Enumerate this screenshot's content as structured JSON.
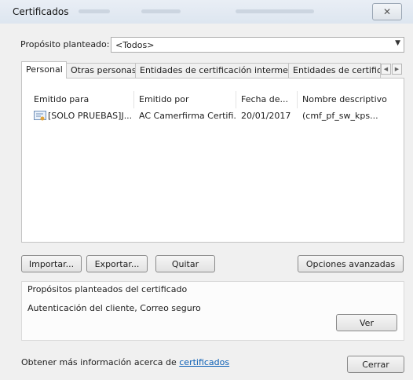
{
  "window": {
    "title": "Certificados",
    "close_symbol": "✕"
  },
  "purpose": {
    "label": "Propósito planteado:",
    "value": "<Todos>"
  },
  "tabs": [
    {
      "label": "Personal",
      "active": true
    },
    {
      "label": "Otras personas",
      "active": false
    },
    {
      "label": "Entidades de certificación intermedias",
      "active": false
    },
    {
      "label": "Entidades de certificaci",
      "active": false
    }
  ],
  "tab_scroll": {
    "left": "◀",
    "right": "▶"
  },
  "table": {
    "columns": [
      "Emitido para",
      "Emitido por",
      "Fecha de...",
      "Nombre descriptivo"
    ],
    "rows": [
      {
        "icon": "certificate-icon",
        "issued_to": "[SOLO PRUEBAS]J...",
        "issued_by": "AC Camerfirma Certifi...",
        "date": "20/01/2017",
        "friendly_name": "(cmf_pf_sw_kps..."
      }
    ]
  },
  "buttons": {
    "import": "Importar...",
    "export": "Exportar...",
    "remove": "Quitar",
    "advanced": "Opciones avanzadas",
    "view": "Ver",
    "close": "Cerrar"
  },
  "purposes_group": {
    "title": "Propósitos planteados del certificado",
    "value": "Autenticación del cliente, Correo seguro"
  },
  "footer": {
    "text": "Obtener más información acerca de ",
    "link": "certificados"
  }
}
